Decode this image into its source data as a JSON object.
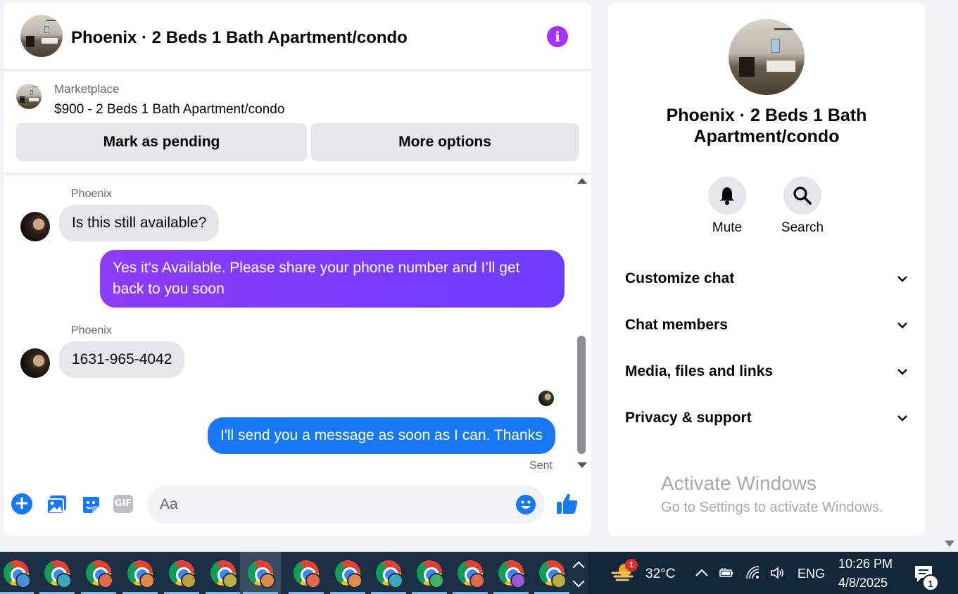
{
  "conversation": {
    "title": "Phoenix · 2 Beds 1 Bath Apartment/condo",
    "info_icon_glyph": "i"
  },
  "listing": {
    "source": "Marketplace",
    "title": "$900 - 2 Beds 1 Bath Apartment/condo",
    "buttons": {
      "mark_pending": "Mark as pending",
      "more_options": "More options"
    }
  },
  "messages": [
    {
      "sender": "Phoenix",
      "direction": "incoming",
      "text": "Is this still available?"
    },
    {
      "sender": "",
      "direction": "outgoing",
      "style": "purple",
      "text": "Yes it's Available. Please share your phone number and I’ll get back to you soon"
    },
    {
      "sender": "Phoenix",
      "direction": "incoming",
      "text": "1631-965-4042"
    },
    {
      "sender": "",
      "direction": "outgoing",
      "style": "blue",
      "text": "I'll send you a message as soon as I can. Thanks"
    }
  ],
  "status": {
    "sent_label": "Sent"
  },
  "composer": {
    "placeholder": "Aa",
    "gif_label": "GIF",
    "icons": [
      "plus-icon",
      "photo-icon",
      "sticker-icon",
      "gif-icon",
      "emoji-icon",
      "thumbs-up-icon"
    ]
  },
  "info_panel": {
    "title": "Phoenix · 2 Beds 1 Bath Apartment/condo",
    "actions": [
      {
        "icon": "bell-icon",
        "label": "Mute"
      },
      {
        "icon": "search-icon",
        "label": "Search"
      }
    ],
    "sections": [
      {
        "label": "Customize chat"
      },
      {
        "label": "Chat members"
      },
      {
        "label": "Media, files and links"
      },
      {
        "label": "Privacy & support"
      }
    ],
    "watermark": {
      "title": "Activate Windows",
      "subtitle": "Go to Settings to activate Windows."
    }
  },
  "taskbar": {
    "weather": {
      "temperature": "32°C",
      "badge": "1"
    },
    "language": "ENG",
    "time": "10:26 PM",
    "date": "4/8/2025",
    "notification_count": "1",
    "chrome_profile_colors": [
      "#4a8fd8",
      "#3aa8b8",
      "#e06a4a",
      "#e08a4a",
      "#c0a040",
      "#b8b040",
      "#e08a4a",
      "#e06a4a",
      "#e08a4a",
      "#3aa8b8",
      "#40b070",
      "#e06a4a",
      "#9a5ad8",
      "#b8b040"
    ]
  },
  "colors": {
    "accent_blue": "#1877f2",
    "accent_purple": "#8d3bf6",
    "info_purple": "#a033ff"
  }
}
